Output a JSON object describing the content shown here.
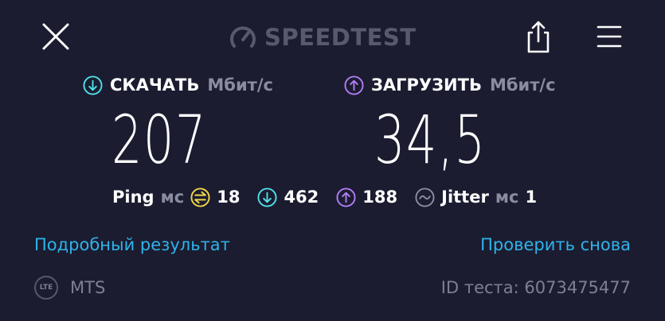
{
  "header": {
    "brand": "SPEEDTEST",
    "icons": {
      "close": "close-icon",
      "share": "share-icon",
      "menu": "hamburger-menu-icon",
      "logo": "speedometer-icon"
    }
  },
  "download": {
    "label": "СКАЧАТЬ",
    "unit": "Мбит/с",
    "value": "207",
    "icon": "arrow-down-circle-icon",
    "color": "#4ee0e6"
  },
  "upload": {
    "label": "ЗАГРУЗИТЬ",
    "unit": "Мбит/с",
    "value": "34,5",
    "icon": "arrow-up-circle-icon",
    "color": "#b27cf5"
  },
  "ping": {
    "label": "Ping",
    "unit": "мс",
    "idle": "18",
    "download": "462",
    "upload": "188",
    "idle_color": "#f2d64b"
  },
  "jitter": {
    "label": "Jitter",
    "unit": "мс",
    "value": "1"
  },
  "links": {
    "details": "Подробный результат",
    "retest": "Проверить снова"
  },
  "footer": {
    "badge": "LTE",
    "provider": "MTS",
    "test_id": "ID теста: 6073475477"
  },
  "colors": {
    "background": "#1b1c30",
    "link": "#2fb3ea",
    "muted": "#8a8ca0"
  }
}
